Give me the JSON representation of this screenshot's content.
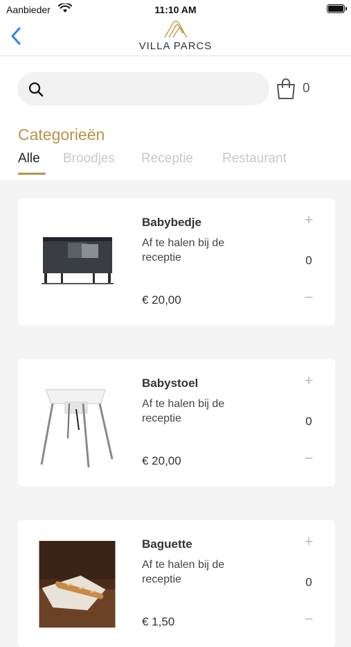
{
  "status_bar": {
    "carrier": "Aanbieder",
    "time": "11:10 AM"
  },
  "header": {
    "brand": "VILLA PARCS",
    "back_icon": "chevron-left-icon"
  },
  "search": {
    "placeholder": "",
    "icon": "search-icon"
  },
  "cart": {
    "icon": "shopping-bag-icon",
    "count": "0"
  },
  "categories": {
    "title": "Categorieën",
    "tabs": [
      "Alle",
      "Broodjes",
      "Receptie",
      "Restaurant"
    ],
    "active": "Alle"
  },
  "products": [
    {
      "name": "Babybedje",
      "description": "Af te halen bij de receptie",
      "price": "€ 20,00",
      "quantity": "0",
      "plus": "+",
      "minus": "−"
    },
    {
      "name": "Babystoel",
      "description": "Af te halen bij de receptie",
      "price": "€ 20,00",
      "quantity": "0",
      "plus": "+",
      "minus": "−"
    },
    {
      "name": "Baguette",
      "description": "Af te halen bij de receptie",
      "price": "€ 1,50",
      "quantity": "0",
      "plus": "+",
      "minus": "−"
    }
  ],
  "colors": {
    "accent": "#b8944a",
    "back": "#2f80ed",
    "background": "#f4f4f4"
  }
}
